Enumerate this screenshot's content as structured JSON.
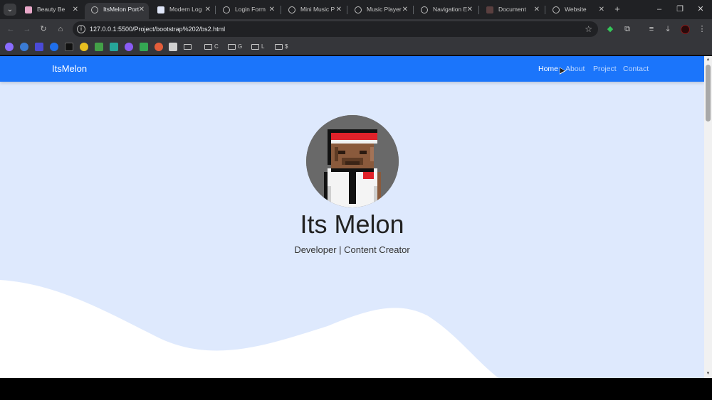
{
  "browser": {
    "tabs": [
      {
        "label": "Beauty Be",
        "favicon": "pink-square-icon",
        "color": "#e8a7c8",
        "active": false
      },
      {
        "label": "ItsMelon Port",
        "favicon": "globe-icon",
        "active": true
      },
      {
        "label": "Modern Log",
        "favicon": "b-logo-icon",
        "color": "#dfe6f8",
        "active": false
      },
      {
        "label": "Login Form",
        "favicon": "globe-icon",
        "active": false
      },
      {
        "label": "Mini Music P",
        "favicon": "globe-icon",
        "active": false
      },
      {
        "label": "Music Player",
        "favicon": "globe-icon",
        "active": false
      },
      {
        "label": "Navigation E",
        "favicon": "globe-icon",
        "active": false
      },
      {
        "label": "Document",
        "favicon": "doc-square-icon",
        "color": "#5a3f3f",
        "active": false
      },
      {
        "label": "Website",
        "favicon": "globe-icon",
        "active": false
      }
    ],
    "tab_close_glyph": "✕",
    "new_tab_glyph": "+",
    "window_controls": {
      "minimize": "–",
      "restore": "❐",
      "close": "✕"
    },
    "tab_search_glyph": "⌄",
    "address": {
      "url": "127.0.0.1:5500/Project/bootstrap%202/bs2.html",
      "info_glyph": "i"
    },
    "nav_glyphs": {
      "back": "←",
      "forward": "→",
      "reload": "↻",
      "home": "⌂",
      "star": "☆"
    },
    "toolbar_glyphs": {
      "extension": "◆",
      "puzzle": "⧉",
      "media": "≡",
      "download": "⤓",
      "menu": "⋮"
    },
    "bookmarks": {
      "icons": [
        {
          "name": "bookmark-wifi-icon",
          "color": "#8a6cff"
        },
        {
          "name": "bookmark-wordpress-icon",
          "color": "#3a7bd5"
        },
        {
          "name": "bookmark-square-blue-icon",
          "color": "#4a4ad8"
        },
        {
          "name": "bookmark-edge-icon",
          "color": "#1f6feb"
        },
        {
          "name": "bookmark-r-icon",
          "color": "#111111"
        },
        {
          "name": "bookmark-star-icon",
          "color": "#e8c020"
        },
        {
          "name": "bookmark-image-icon",
          "color": "#43a047"
        },
        {
          "name": "bookmark-photo-icon",
          "color": "#26a69a"
        },
        {
          "name": "bookmark-sparkle-icon",
          "color": "#8a5cf5"
        },
        {
          "name": "bookmark-plus-icon",
          "color": "#34a853"
        },
        {
          "name": "bookmark-figma-icon",
          "color": "#e35d3a"
        },
        {
          "name": "bookmark-x-icon",
          "color": "#d0d0d0"
        }
      ],
      "folders": [
        "",
        "C",
        "G",
        "L",
        "$"
      ]
    }
  },
  "site": {
    "brand": "ItsMelon",
    "nav": [
      {
        "label": "Home",
        "active": true
      },
      {
        "label": "About",
        "active": false
      },
      {
        "label": "Project",
        "active": false
      },
      {
        "label": "Contact",
        "active": false
      }
    ],
    "hero": {
      "title": "Its Melon",
      "subtitle": "Developer | Content Creator"
    },
    "colors": {
      "navbar": "#1b75fb",
      "background": "#dee9fd",
      "wave": "#ffffff",
      "avatar_bg": "#696969"
    }
  },
  "scrollbar": {
    "up": "▲",
    "down": "▼"
  }
}
